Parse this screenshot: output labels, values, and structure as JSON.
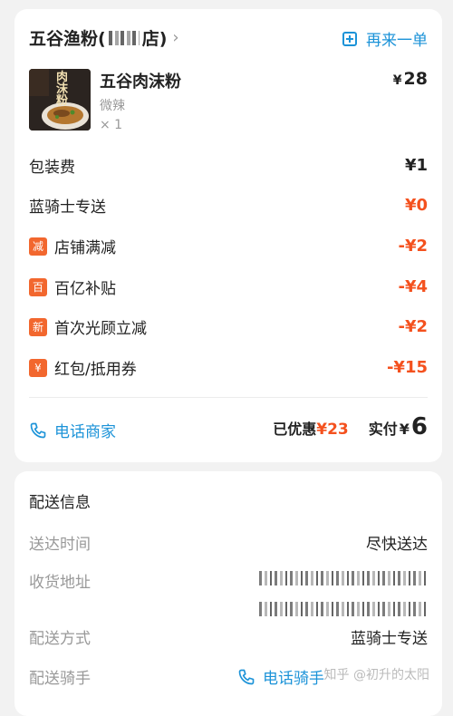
{
  "store": {
    "name_prefix": "五谷渔粉(",
    "name_suffix": "店)"
  },
  "reorder_label": "再来一单",
  "item": {
    "name": "五谷肉沫粉",
    "spec": "微辣",
    "qty": "× 1",
    "price": "28",
    "thumb_text": "肉沫粉"
  },
  "currency": "¥",
  "fees": [
    {
      "label": "包装费",
      "value": "¥1",
      "tag": ""
    },
    {
      "label": "蓝骑士专送",
      "value": "¥0",
      "tag": ""
    },
    {
      "label": "店铺满减",
      "value": "-¥2",
      "tag": "减"
    },
    {
      "label": "百亿补贴",
      "value": "-¥4",
      "tag": "百"
    },
    {
      "label": "首次光顾立减",
      "value": "-¥2",
      "tag": "新"
    },
    {
      "label": "红包/抵用券",
      "value": "-¥15",
      "tag": "¥"
    }
  ],
  "footer": {
    "call_merchant": "电话商家",
    "saved_label": "已优惠",
    "saved_value": "¥23",
    "paid_label": "实付",
    "paid_value": "6"
  },
  "delivery": {
    "title": "配送信息",
    "time_label": "送达时间",
    "time_value": "尽快送达",
    "address_label": "收货地址",
    "method_label": "配送方式",
    "method_value": "蓝骑士专送",
    "rider_label": "配送骑手",
    "call_rider": "电话骑手"
  },
  "watermark": "知乎 @初升的太阳",
  "colors": {
    "accent_blue": "#1c93d8",
    "discount_orange": "#f4511e"
  }
}
